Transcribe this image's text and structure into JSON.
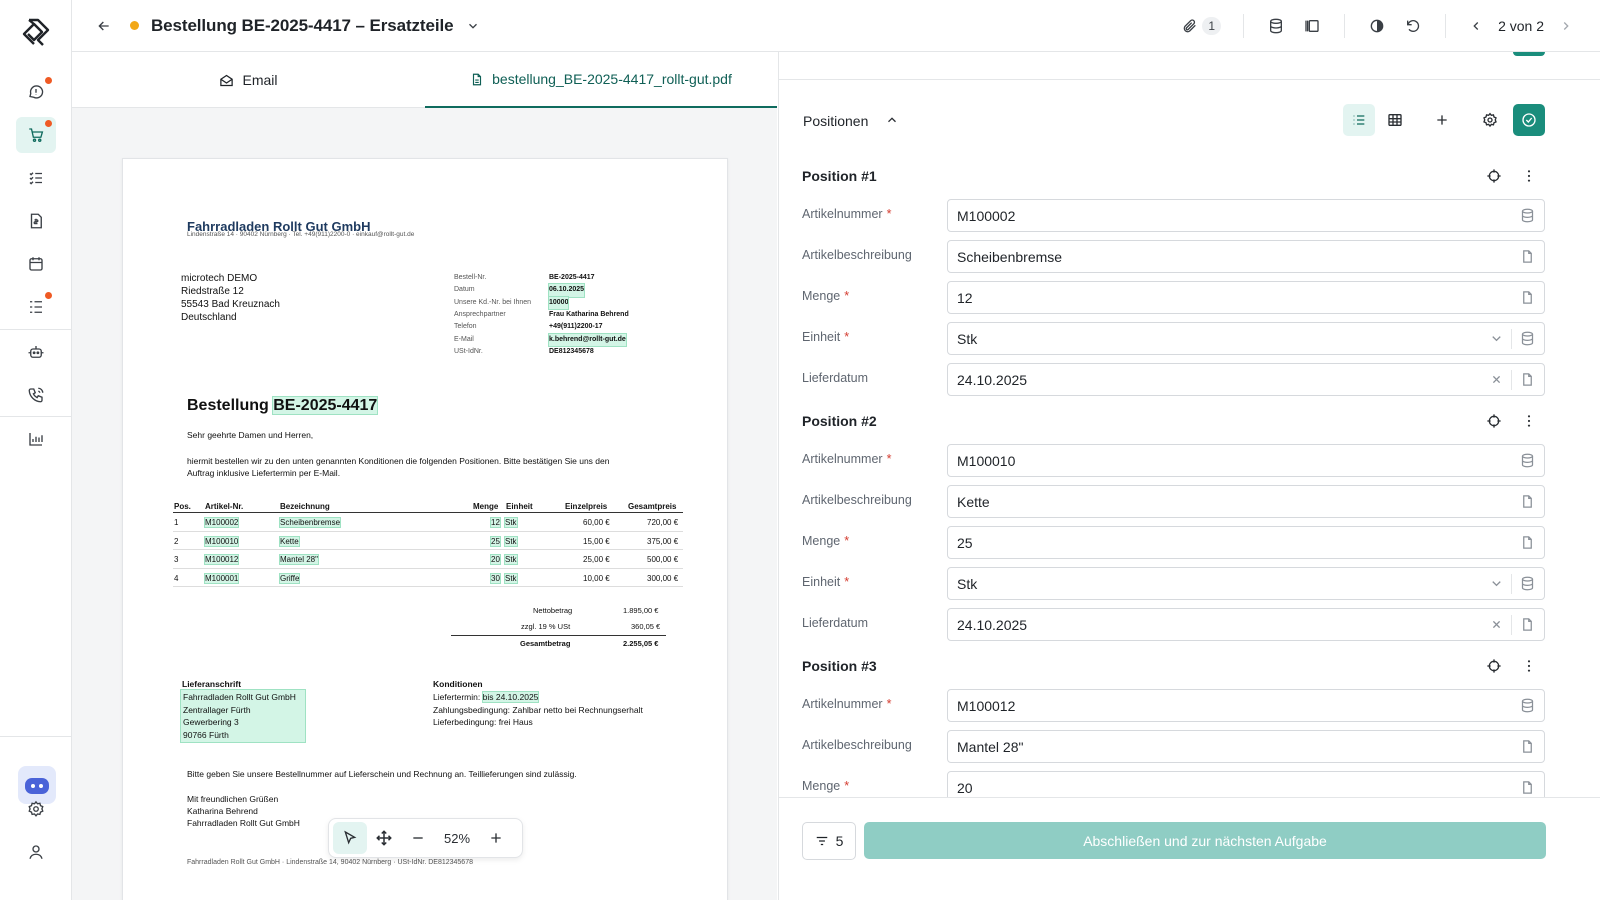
{
  "header": {
    "title": "Bestellung BE-2025-4417 – Ersatzteile",
    "attachment_count": "1",
    "pager": "2 von 2",
    "status_color": "#f2a818"
  },
  "tabs": [
    {
      "label": "Email"
    },
    {
      "label": "bestellung_BE-2025-4417_rollt-gut.pdf"
    }
  ],
  "doc": {
    "company": "Fahrradladen Rollt Gut GmbH",
    "company_line": "Lindenstraße 14 · 90402 Nürnberg · Tel. +49(911)2200-0 · einkauf@rollt-gut.de",
    "recipient": [
      "microtech DEMO",
      "Riedstraße 12",
      "55543 Bad Kreuznach",
      "Deutschland"
    ],
    "meta": [
      {
        "label": "Bestell-Nr.",
        "value": "BE-2025-4417"
      },
      {
        "label": "Datum",
        "value": "06.10.2025"
      },
      {
        "label": "Unsere Kd.-Nr. bei Ihnen",
        "value": "10000"
      },
      {
        "label": "Ansprechpartner",
        "value": "Frau Katharina Behrend"
      },
      {
        "label": "Telefon",
        "value": "+49(911)2200-17"
      },
      {
        "label": "E-Mail",
        "value": "k.behrend@rollt-gut.de"
      },
      {
        "label": "USt-IdNr.",
        "value": "DE812345678"
      }
    ],
    "heading_prefix": "Bestellung",
    "heading_number": "BE-2025-4417",
    "greeting": "Sehr geehrte Damen und Herren,",
    "intro_1": "hiermit bestellen wir zu den unten genannten Konditionen die folgenden Positionen. Bitte bestätigen Sie uns den",
    "intro_2": "Auftrag inklusive Liefertermin per E-Mail.",
    "table_headers": [
      "Pos.",
      "Artikel-Nr.",
      "Bezeichnung",
      "Menge",
      "Einheit",
      "Einzelpreis",
      "Gesamtpreis"
    ],
    "table_rows": [
      [
        "1",
        "M100002",
        "Scheibenbremse",
        "12",
        "Stk",
        "60,00 €",
        "720,00 €"
      ],
      [
        "2",
        "M100010",
        "Kette",
        "25",
        "Stk",
        "15,00 €",
        "375,00 €"
      ],
      [
        "3",
        "M100012",
        "Mantel 28\"",
        "20",
        "Stk",
        "25,00 €",
        "500,00 €"
      ],
      [
        "4",
        "M100001",
        "Griffe",
        "30",
        "Stk",
        "10,00 €",
        "300,00 €"
      ]
    ],
    "totals": [
      {
        "label": "Nettobetrag",
        "value": "1.895,00 €"
      },
      {
        "label": "zzgl. 19 % USt",
        "value": "360,05 €"
      },
      {
        "label": "Gesamtbetrag",
        "value": "2.255,05 €"
      }
    ],
    "delivery_title": "Lieferanschrift",
    "delivery_lines": [
      "Fahrradladen Rollt Gut GmbH",
      "Zentrallager Fürth",
      "Gewerbering 3",
      "90766 Fürth"
    ],
    "conditions_title": "Konditionen",
    "cond_delivery_label": "Liefertermin:",
    "cond_delivery_value": "bis 24.10.2025",
    "cond_payment": "Zahlungsbedingung: Zahlbar netto bei Rechnungserhalt",
    "cond_shipping": "Lieferbedingung: frei Haus",
    "note": "Bitte geben Sie unsere Bestellnummer auf Lieferschein und Rechnung an. Teillieferungen sind zulässig.",
    "closing": [
      "Mit freundlichen Grüßen",
      "Katharina Behrend",
      "Fahrradladen Rollt Gut GmbH"
    ],
    "footer_line": "Fahrradladen Rollt Gut GmbH · Lindenstraße 14, 90402 Nürnberg · USt-IdNr. DE812345678"
  },
  "viewer": {
    "zoom": "52%"
  },
  "panel": {
    "section_title": "Positionen",
    "labels": {
      "article_number": "Artikelnummer",
      "description": "Artikelbeschreibung",
      "quantity": "Menge",
      "unit": "Einheit",
      "delivery_date": "Lieferdatum"
    },
    "positions": [
      {
        "title": "Position #1",
        "article_number": "M100002",
        "description": "Scheibenbremse",
        "quantity": "12",
        "unit": "Stk",
        "delivery_date": "24.10.2025"
      },
      {
        "title": "Position #2",
        "article_number": "M100010",
        "description": "Kette",
        "quantity": "25",
        "unit": "Stk",
        "delivery_date": "24.10.2025"
      },
      {
        "title": "Position #3",
        "article_number": "M100012",
        "description": "Mantel 28\"",
        "quantity": "20"
      }
    ],
    "filter_count": "5",
    "submit_label": "Abschließen und zur nächsten Aufgabe",
    "accent_color": "#1a8d7c"
  }
}
